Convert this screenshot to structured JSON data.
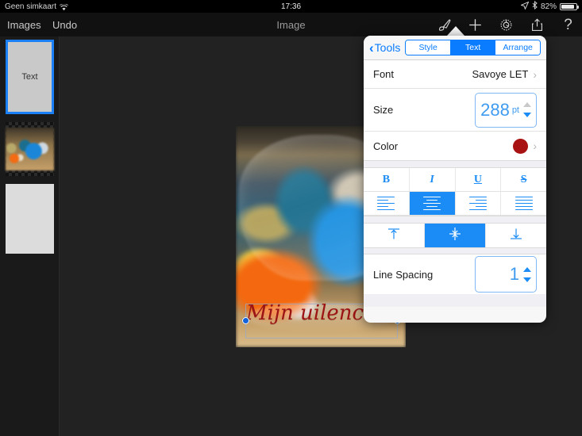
{
  "status_bar": {
    "carrier": "Geen simkaart",
    "wifi_icon": "wifi-icon",
    "time": "17:36",
    "location_icon": "location-arrow-icon",
    "bluetooth_icon": "bluetooth-icon",
    "battery_percent": "82%",
    "battery_level": 82
  },
  "nav_bar": {
    "back_label": "Images",
    "undo_label": "Undo",
    "title": "Image",
    "icons": [
      {
        "name": "tools-brush-icon",
        "active": true
      },
      {
        "name": "add-icon",
        "active": false
      },
      {
        "name": "settings-gear-icon",
        "active": false
      },
      {
        "name": "share-icon",
        "active": false
      },
      {
        "name": "help-icon",
        "glyph": "?",
        "active": false
      }
    ]
  },
  "sidebar": {
    "layers": [
      {
        "name": "text-layer",
        "label": "Text",
        "selected": true
      },
      {
        "name": "image-layer",
        "label": "",
        "selected": false
      },
      {
        "name": "blank-layer",
        "label": "",
        "selected": false
      }
    ]
  },
  "canvas": {
    "caption": "Mijn uilencollectie",
    "caption_color": "#9c1414",
    "selection_handles": 2
  },
  "popover": {
    "back_label": "Tools",
    "tabs": [
      {
        "label": "Style",
        "active": false
      },
      {
        "label": "Text",
        "active": true
      },
      {
        "label": "Arrange",
        "active": false
      }
    ],
    "font": {
      "label": "Font",
      "value": "Savoye LET"
    },
    "size": {
      "label": "Size",
      "value": "288",
      "unit": "pt",
      "up_enabled": false,
      "down_enabled": true
    },
    "color": {
      "label": "Color",
      "value": "#a81212"
    },
    "style_buttons": [
      {
        "label": "B",
        "name": "bold-button",
        "active": false
      },
      {
        "label": "I",
        "name": "italic-button",
        "active": false
      },
      {
        "label": "U",
        "name": "underline-button",
        "active": false
      },
      {
        "label": "S",
        "name": "strikethrough-button",
        "active": false
      }
    ],
    "align_buttons": [
      {
        "name": "align-left-button",
        "active": false
      },
      {
        "name": "align-center-button",
        "active": true
      },
      {
        "name": "align-right-button",
        "active": false
      },
      {
        "name": "align-justify-button",
        "active": false
      }
    ],
    "valign_buttons": [
      {
        "name": "valign-top-button",
        "active": false
      },
      {
        "name": "valign-middle-button",
        "active": true
      },
      {
        "name": "valign-bottom-button",
        "active": false
      }
    ],
    "line_spacing": {
      "label": "Line Spacing",
      "value": "1",
      "up_enabled": true,
      "down_enabled": true
    }
  },
  "colors": {
    "accent_blue": "#0a7cff",
    "selection_blue": "#1b7ff5",
    "text_red": "#9c1414",
    "swatch_red": "#a81212"
  }
}
